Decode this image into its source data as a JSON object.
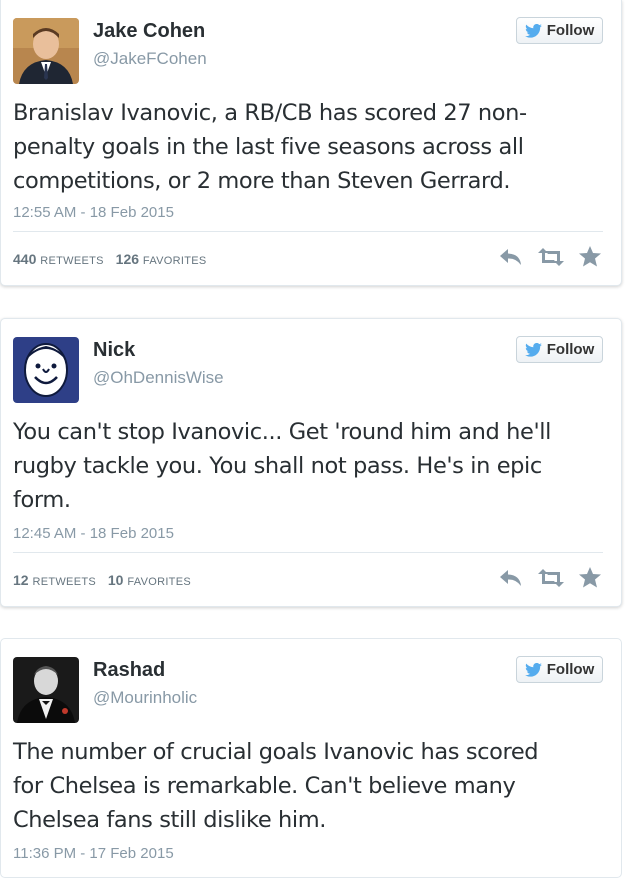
{
  "tweets": [
    {
      "name": "Jake Cohen",
      "handle": "@JakeFCohen",
      "follow_label": "Follow",
      "text": "Branislav Ivanovic, a RB/CB has scored 27 non-penalty goals in the last five seasons across all competitions, or 2 more than Steven Gerrard.",
      "time": "12:55 AM - 18 Feb 2015",
      "retweets": "440",
      "retweets_label": "Retweets",
      "favorites": "126",
      "favorites_label": "Favorites"
    },
    {
      "name": "Nick",
      "handle": "@OhDennisWise",
      "follow_label": "Follow",
      "text": "You can't stop Ivanovic... Get 'round him and he'll rugby tackle you. You shall not pass. He's in epic form.",
      "time": "12:45 AM - 18 Feb 2015",
      "retweets": "12",
      "retweets_label": "Retweets",
      "favorites": "10",
      "favorites_label": "Favorites"
    },
    {
      "name": "Rashad",
      "handle": "@Mourinholic",
      "follow_label": "Follow",
      "text": "The number of crucial goals Ivanovic has scored for Chelsea is remarkable. Can't believe many Chelsea fans still dislike him.",
      "time": "11:36 PM - 17 Feb 2015"
    }
  ],
  "colors": {
    "twitter_blue": "#55acee",
    "muted": "#8899a6",
    "text": "#292f33"
  },
  "icons": [
    "twitter-bird-icon",
    "reply-icon",
    "retweet-icon",
    "favorite-star-icon"
  ]
}
